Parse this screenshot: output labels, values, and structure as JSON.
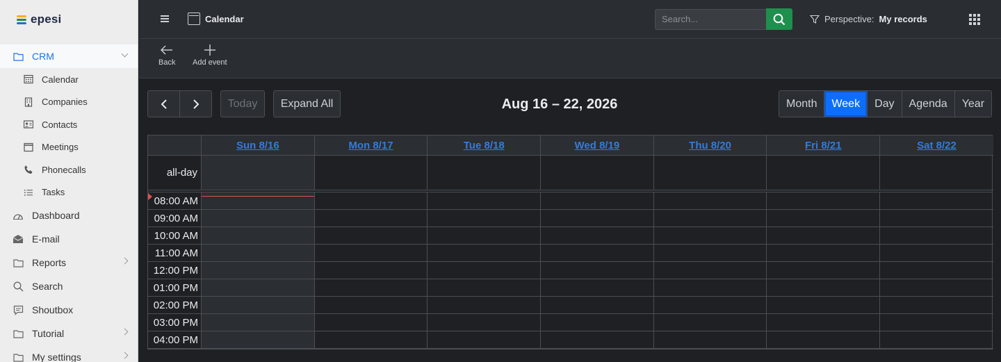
{
  "app": {
    "logo_text": "epesi",
    "logo_colors": [
      "#f2b01e",
      "#2a8c4a",
      "#1d6fd1"
    ]
  },
  "sidebar": {
    "items": [
      {
        "label": "CRM",
        "icon": "folder-icon",
        "active": true,
        "chevron": "down"
      },
      {
        "label": "Dashboard",
        "icon": "dashboard-icon",
        "chevron": null
      },
      {
        "label": "E-mail",
        "icon": "envelope-icon",
        "chevron": null
      },
      {
        "label": "Reports",
        "icon": "folder-icon",
        "chevron": "right"
      },
      {
        "label": "Search",
        "icon": "search-icon",
        "chevron": null
      },
      {
        "label": "Shoutbox",
        "icon": "chat-icon",
        "chevron": null
      },
      {
        "label": "Tutorial",
        "icon": "folder-icon",
        "chevron": "right"
      },
      {
        "label": "My settings",
        "icon": "folder-icon",
        "chevron": "right"
      }
    ],
    "crm_subitems": [
      {
        "label": "Calendar",
        "icon": "calendar-icon"
      },
      {
        "label": "Companies",
        "icon": "building-icon"
      },
      {
        "label": "Contacts",
        "icon": "contact-card-icon"
      },
      {
        "label": "Meetings",
        "icon": "window-icon"
      },
      {
        "label": "Phonecalls",
        "icon": "phone-icon"
      },
      {
        "label": "Tasks",
        "icon": "list-icon"
      }
    ]
  },
  "header": {
    "title": "Calendar",
    "search_placeholder": "Search...",
    "perspective_label": "Perspective:",
    "perspective_value": "My records"
  },
  "toolbar": {
    "back_label": "Back",
    "add_event_label": "Add event"
  },
  "calendar": {
    "range_title": "Aug 16 – 22, 2026",
    "today_label": "Today",
    "expand_label": "Expand All",
    "views": [
      "Month",
      "Week",
      "Day",
      "Agenda",
      "Year"
    ],
    "active_view": "Week",
    "days": [
      "Sun 8/16",
      "Mon 8/17",
      "Tue 8/18",
      "Wed 8/19",
      "Thu 8/20",
      "Fri 8/21",
      "Sat 8/22"
    ],
    "today_index": 0,
    "allday_label": "all-day",
    "times": [
      "08:00 AM",
      "09:00 AM",
      "10:00 AM",
      "11:00 AM",
      "12:00 PM",
      "01:00 PM",
      "02:00 PM",
      "03:00 PM",
      "04:00 PM"
    ],
    "colors": {
      "accent": "#0d6efd",
      "link": "#2f7de1",
      "now_indicator": "#d9534f",
      "search_button": "#1f8f4e"
    }
  }
}
